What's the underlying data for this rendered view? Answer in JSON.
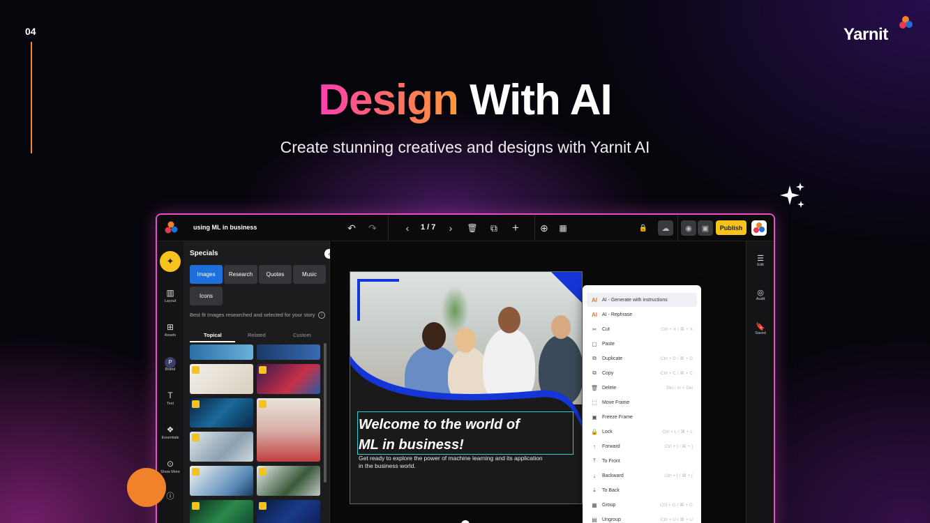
{
  "slide": {
    "number": "04"
  },
  "brand": {
    "name": "Yarnit"
  },
  "hero": {
    "title_highlight": "Design",
    "title_rest": "With AI",
    "subtitle": "Create stunning creatives and designs with Yarnit AI"
  },
  "app": {
    "topbar": {
      "title": "using ML in business",
      "page_indicator": "1 / 7",
      "publish_label": "Publish",
      "icons": [
        "undo-icon",
        "redo-icon",
        "prev-page-icon",
        "next-page-icon",
        "trash-icon",
        "duplicate-icon",
        "add-icon",
        "zoom-icon",
        "grid-icon",
        "lock-icon",
        "cloud-icon",
        "preview-icon",
        "save-icon"
      ]
    },
    "leftrail": [
      {
        "label": "",
        "icon": "magic-icon"
      },
      {
        "label": "Layout",
        "icon": "layout-icon"
      },
      {
        "label": "Assets",
        "icon": "assets-icon"
      },
      {
        "label": "Brand",
        "icon": "brand-icon",
        "glyph": "P"
      },
      {
        "label": "Text",
        "icon": "text-icon"
      },
      {
        "label": "Essentials",
        "icon": "essentials-icon"
      },
      {
        "label": "Show More",
        "icon": "more-icon"
      },
      {
        "label": "",
        "icon": "help-icon"
      }
    ],
    "panel": {
      "title": "Specials",
      "chips": [
        "Images",
        "Research",
        "Quotes",
        "Music",
        "Icons"
      ],
      "description": "Best fit Images researched and selected for your story",
      "subtabs": [
        "Topical",
        "Related",
        "Custom"
      ]
    },
    "rightrail": [
      {
        "label": "Edit",
        "icon": "sliders-icon"
      },
      {
        "label": "Audit",
        "icon": "audit-icon"
      },
      {
        "label": "Saved",
        "icon": "bookmark-icon"
      }
    ],
    "artboard": {
      "headline_line1": "Welcome to the world of",
      "headline_line2": "ML in business!",
      "body": "Get ready to explore the power of machine learning and its application in the business world."
    },
    "context_menu": [
      {
        "icon": "ai-icon",
        "glyph": "AI",
        "label": "AI - Generate with instructions",
        "shortcut": ""
      },
      {
        "icon": "ai-icon",
        "glyph": "AI",
        "label": "AI - Rephrase",
        "shortcut": ""
      },
      {
        "icon": "scissors-icon",
        "glyph": "✂",
        "label": "Cut",
        "shortcut": "Ctrl + X / ⌘ + X"
      },
      {
        "icon": "paste-icon",
        "glyph": "▢",
        "label": "Paste",
        "shortcut": ""
      },
      {
        "icon": "duplicate-icon",
        "glyph": "⧉",
        "label": "Duplicate",
        "shortcut": "Ctrl + D / ⌘ + D"
      },
      {
        "icon": "copy-icon",
        "glyph": "⧉",
        "label": "Copy",
        "shortcut": "Ctrl + C / ⌘ + C"
      },
      {
        "icon": "trash-icon",
        "glyph": "🗑",
        "label": "Delete",
        "shortcut": "Del / In + Del"
      },
      {
        "icon": "move-frame-icon",
        "glyph": "⬚",
        "label": "Move Frame",
        "shortcut": ""
      },
      {
        "icon": "freeze-frame-icon",
        "glyph": "▣",
        "label": "Freeze Frame",
        "shortcut": ""
      },
      {
        "icon": "lock-icon",
        "glyph": "🔒",
        "label": "Lock",
        "shortcut": "Ctrl + L / ⌘ + L"
      },
      {
        "icon": "forward-icon",
        "glyph": "↑",
        "label": "Forward",
        "shortcut": "Ctrl + ] / ⌘ + ]"
      },
      {
        "icon": "to-front-icon",
        "glyph": "⤒",
        "label": "To Front",
        "shortcut": ""
      },
      {
        "icon": "backward-icon",
        "glyph": "↓",
        "label": "Backward",
        "shortcut": "Ctrl + [ / ⌘ + ["
      },
      {
        "icon": "to-back-icon",
        "glyph": "⤓",
        "label": "To Back",
        "shortcut": ""
      },
      {
        "icon": "group-icon",
        "glyph": "▦",
        "label": "Group",
        "shortcut": "Ctrl + G / ⌘ + G"
      },
      {
        "icon": "ungroup-icon",
        "glyph": "▤",
        "label": "Ungroup",
        "shortcut": "Ctrl + U / ⌘ + U"
      }
    ]
  },
  "colors": {
    "accent": "#f6c21c",
    "brand_pink": "#e64fc6",
    "canvas_blue": "#1436d6",
    "selection": "#2ecfd9",
    "orange": "#f0832a"
  }
}
